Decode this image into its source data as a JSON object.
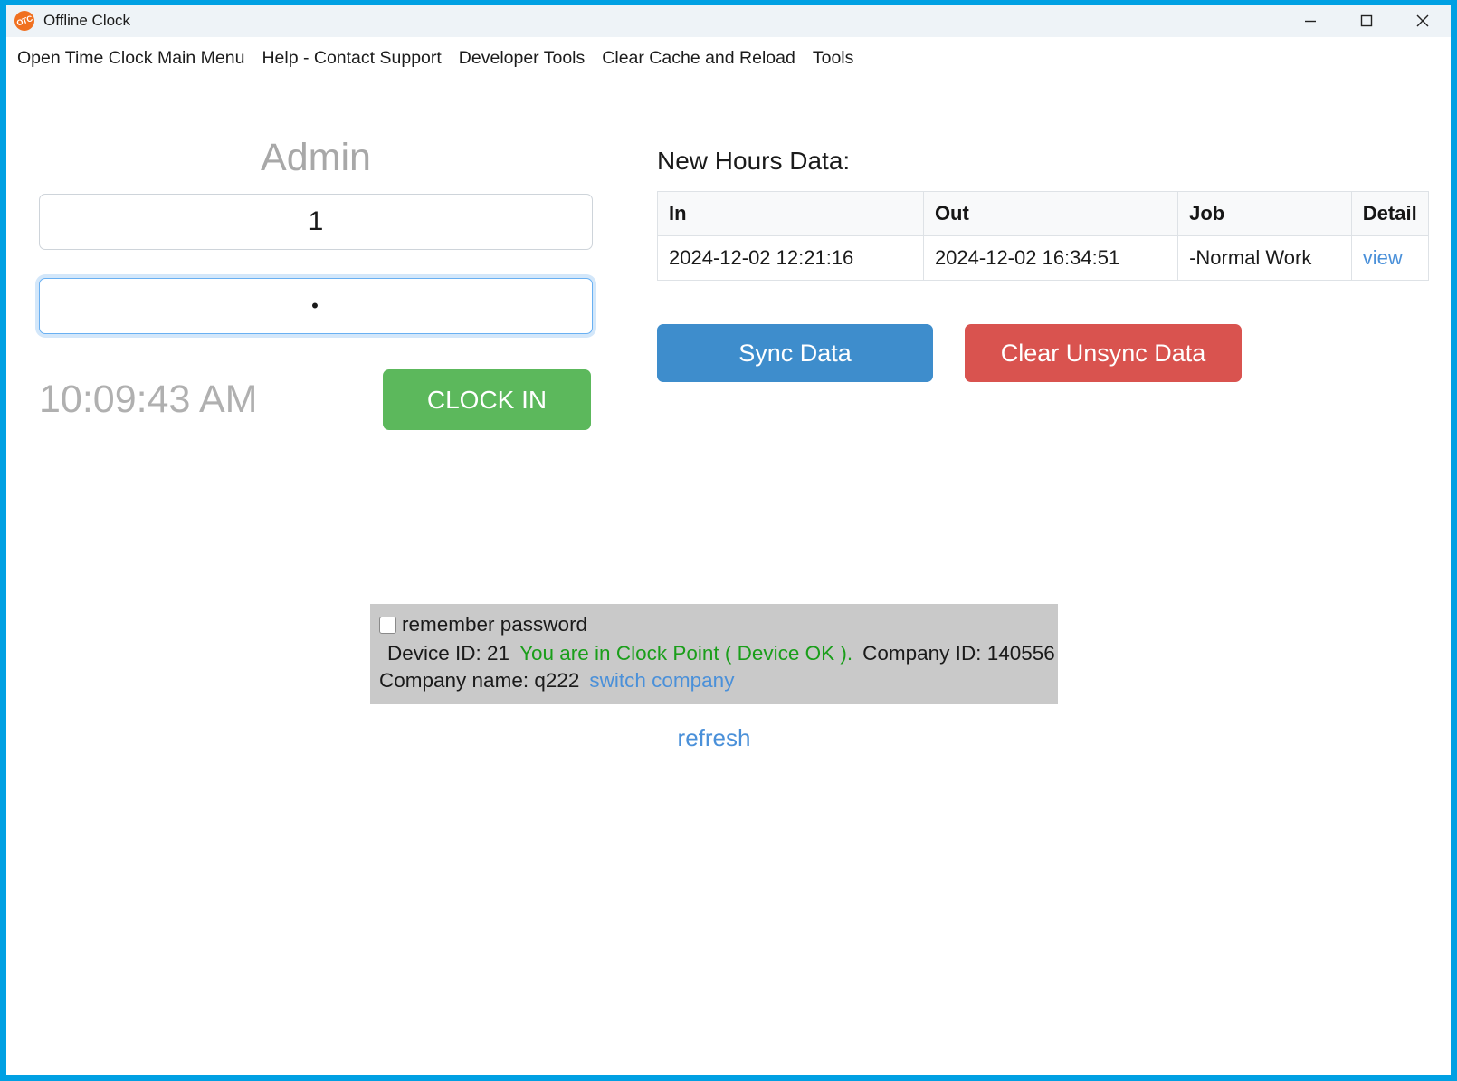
{
  "window": {
    "title": "Offline Clock",
    "logo_text": "OTC",
    "accent_color": "#00a0e3",
    "controls": {
      "minimize": "minimize-icon",
      "maximize": "maximize-icon",
      "close": "close-icon"
    }
  },
  "menubar": {
    "items": [
      {
        "label": "Open Time Clock Main Menu"
      },
      {
        "label": "Help - Contact Support"
      },
      {
        "label": "Developer Tools"
      },
      {
        "label": "Clear Cache and Reload"
      },
      {
        "label": "Tools"
      }
    ]
  },
  "login": {
    "heading": "Admin",
    "username_value": "1",
    "username_placeholder": "",
    "password_value": "•",
    "password_placeholder": "",
    "clock_time": "10:09:43 AM",
    "clock_in_label": "CLOCK IN",
    "clock_in_color": "#5cb85c"
  },
  "hours": {
    "title": "New Hours Data:",
    "columns": [
      "In",
      "Out",
      "Job",
      "Detail"
    ],
    "rows": [
      {
        "in": "2024-12-02 12:21:16",
        "out": "2024-12-02 16:34:51",
        "job": "-Normal Work",
        "detail": "view"
      }
    ],
    "sync_label": "Sync Data",
    "sync_color": "#3e8dcc",
    "clear_label": "Clear Unsync Data",
    "clear_color": "#d9534f"
  },
  "status": {
    "remember_label": "remember password",
    "remember_checked": false,
    "device_id_label": "Device ID: 21",
    "device_status": "You are in Clock Point ( Device OK ).",
    "device_status_color": "#1a9e1a",
    "company_id_label": "Company ID: 140556",
    "company_name_label": "Company name: q222",
    "switch_company_link": "switch company",
    "refresh_link": "refresh",
    "link_color": "#4a90d9"
  }
}
